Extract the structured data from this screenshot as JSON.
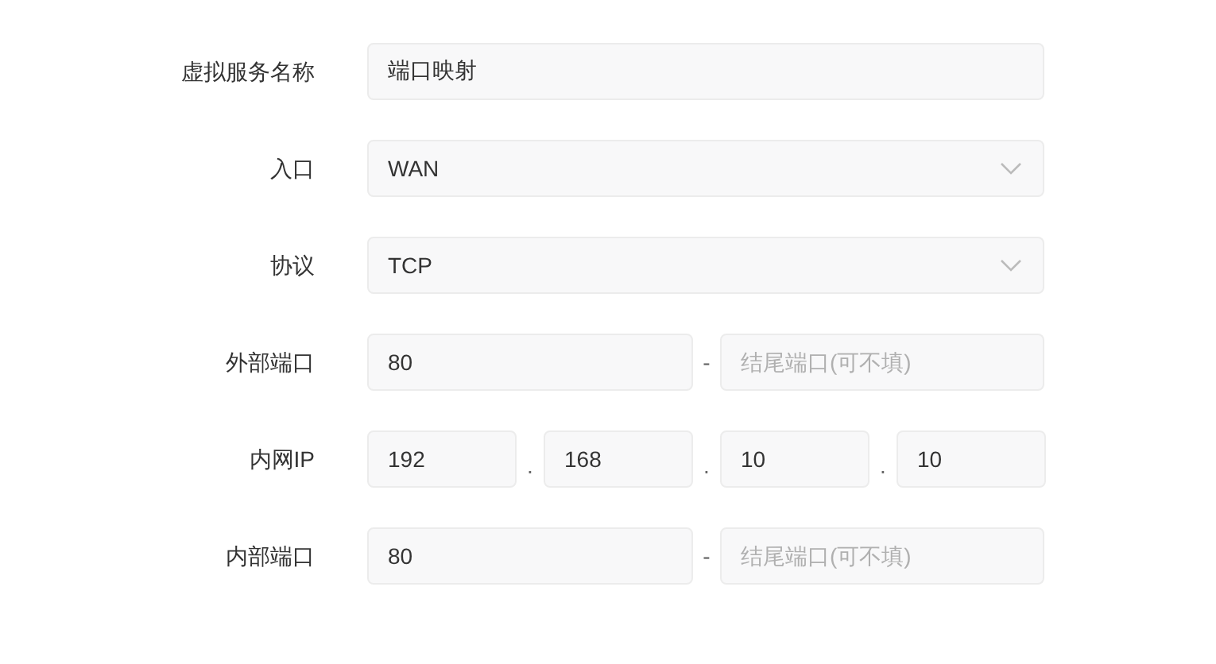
{
  "fields": [
    {
      "kind": "text",
      "label": "虚拟服务名称",
      "value": "端口映射"
    },
    {
      "kind": "select",
      "label": "入口",
      "value": "WAN"
    },
    {
      "kind": "select",
      "label": "协议",
      "value": "TCP"
    },
    {
      "kind": "range",
      "label": "外部端口",
      "value": "80",
      "separator": "-",
      "end_placeholder": "结尾端口(可不填)"
    },
    {
      "kind": "ip",
      "label": "内网IP",
      "octets": [
        "192",
        "168",
        "10",
        "10"
      ],
      "separators": [
        ".",
        ".",
        "."
      ]
    },
    {
      "kind": "range",
      "label": "内部端口",
      "value": "80",
      "separator": "-",
      "end_placeholder": "结尾端口(可不填)"
    }
  ]
}
